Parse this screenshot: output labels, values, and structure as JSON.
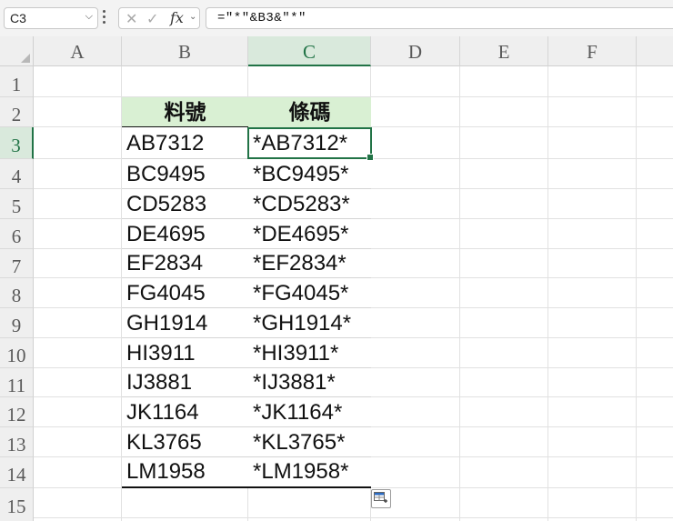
{
  "formula_bar": {
    "name_box": "C3",
    "formula": "=\"*\"&B3&\"*\"",
    "icons": [
      "chevron-down-icon",
      "more-icon",
      "cancel-icon",
      "check-icon",
      "function-icon"
    ],
    "fx_label": "fx"
  },
  "columns": [
    "A",
    "B",
    "C",
    "D",
    "E",
    "F"
  ],
  "rows": [
    "1",
    "2",
    "3",
    "4",
    "5",
    "6",
    "7",
    "8",
    "9",
    "10",
    "11",
    "12",
    "13",
    "14",
    "15"
  ],
  "selection": {
    "column": "C",
    "row": "3"
  },
  "table": {
    "headers": [
      "料號",
      "條碼"
    ],
    "rows": [
      [
        "AB7312",
        "*AB7312*"
      ],
      [
        "BC9495",
        "*BC9495*"
      ],
      [
        "CD5283",
        "*CD5283*"
      ],
      [
        "DE4695",
        "*DE4695*"
      ],
      [
        "EF2834",
        "*EF2834*"
      ],
      [
        "FG4045",
        "*FG4045*"
      ],
      [
        "GH1914",
        "*GH1914*"
      ],
      [
        "HI3911",
        "*HI3911*"
      ],
      [
        "IJ3881",
        "*IJ3881*"
      ],
      [
        "JK1164",
        "*JK1164*"
      ],
      [
        "KL3765",
        "*KL3765*"
      ],
      [
        "LM1958",
        "*LM1958*"
      ]
    ]
  },
  "colors": {
    "accent": "#217346",
    "header_fill": "#d9f0d3"
  }
}
